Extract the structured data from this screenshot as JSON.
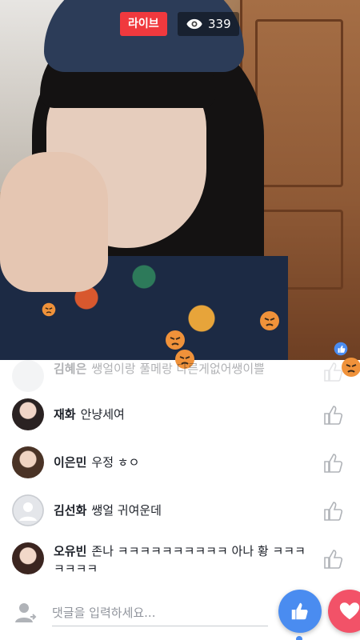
{
  "header": {
    "live_label": "라이브",
    "viewer_count": "339"
  },
  "comments": [
    {
      "name": "김혜은",
      "text": "쌩얼이랑 풀메랑 다른게없어쌩이쁠",
      "faded": true
    },
    {
      "name": "재화",
      "text": "안냥세여"
    },
    {
      "name": "이은민",
      "text": "우정 ㅎㅇ"
    },
    {
      "name": "김선화",
      "text": "쌩얼 귀여운데"
    },
    {
      "name": "오유빈",
      "text": "존나 ㅋㅋㅋㅋㅋㅋㅋㅋㅋㅋ 아나 황 ㅋㅋㅋㅋㅋㅋㅋ"
    }
  ],
  "input": {
    "placeholder": "댓글을 입력하세요..."
  },
  "colors": {
    "live_red": "#f0393e",
    "like_blue": "#4a8cf0",
    "heart_pink": "#f25268",
    "angry_orange": "#f0923a"
  },
  "icons": {
    "viewer": "eye-icon",
    "reaction": "angry-reaction-icon",
    "comment_like": "thumbs-up-icon",
    "user": "person-icon",
    "like_button": "thumbs-up-icon",
    "love_button": "heart-icon"
  }
}
